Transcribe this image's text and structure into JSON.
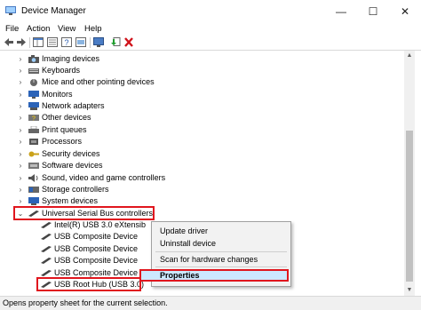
{
  "window": {
    "title": "Device Manager",
    "minimize": "—",
    "maximize": "☐",
    "close": "✕"
  },
  "menubar": {
    "items": [
      "File",
      "Action",
      "View",
      "Help"
    ]
  },
  "toolbar": {
    "icons": [
      "back-arrow-icon",
      "forward-arrow-icon",
      "show-hide-console-icon",
      "properties-icon",
      "help-icon",
      "scan-hardware-icon",
      "display-icon",
      "update-driver-icon",
      "uninstall-icon"
    ]
  },
  "tree": {
    "categories": [
      "Imaging devices",
      "Keyboards",
      "Mice and other pointing devices",
      "Monitors",
      "Network adapters",
      "Other devices",
      "Print queues",
      "Processors",
      "Security devices",
      "Software devices",
      "Sound, video and game controllers",
      "Storage controllers",
      "System devices"
    ],
    "expanded": "Universal Serial Bus controllers",
    "children": [
      "Intel(R) USB 3.0 eXtensib",
      "USB Composite Device",
      "USB Composite Device",
      "USB Composite Device",
      "USB Composite Device",
      "USB Root Hub (USB 3.0)"
    ]
  },
  "context_menu": {
    "update": "Update driver",
    "uninstall": "Uninstall device",
    "scan": "Scan for hardware changes",
    "properties": "Properties"
  },
  "status": {
    "text": "Opens property sheet for the current selection."
  },
  "colors": {
    "highlight_box": "#e0161e",
    "selection": "#cce8ff"
  }
}
